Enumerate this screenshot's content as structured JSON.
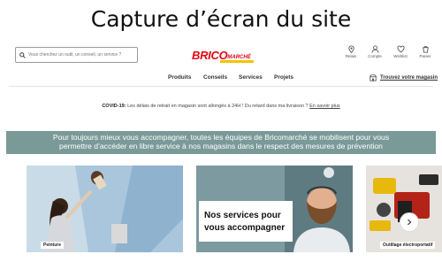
{
  "caption": "Capture d’écran du site",
  "search": {
    "placeholder": "Vous cherchez un outil, un conseil, un service ?"
  },
  "logo": {
    "brico": "BRICO",
    "marche": "MARCHÉ"
  },
  "header_icons": [
    {
      "icon": "location-pin-icon",
      "label": "Relais"
    },
    {
      "icon": "user-icon",
      "label": "Compte"
    },
    {
      "icon": "heart-icon",
      "label": "Wishlist"
    },
    {
      "icon": "cart-icon",
      "label": "Panier"
    }
  ],
  "nav": {
    "items": [
      "Produits",
      "Conseils",
      "Services",
      "Projets"
    ],
    "store_link": "Trouvez votre magasin"
  },
  "notice": {
    "title": "COVID-19:",
    "text": "Les délais de retrait en magasin sont allongés à 24H ! Du retard dans ma livraison ?",
    "link": "En savoir plus"
  },
  "banner": {
    "line1": "Pour toujours mieux vous accompagner, toutes les équipes de Bricomarché se mobilisent pour vous",
    "line2": "permettre d’accéder en libre service à nos magasins dans le respect des mesures de prévention"
  },
  "cards": [
    {
      "label": "Peinture"
    },
    {
      "label": "Nos services pour vous accompagner",
      "line1": "Nos services pour",
      "line2": "vous accompagner"
    },
    {
      "label": "Outillage électroportatif"
    }
  ],
  "colors": {
    "brand_red": "#e30613",
    "brand_yellow": "#f4c400",
    "banner": "#7a9a98"
  }
}
